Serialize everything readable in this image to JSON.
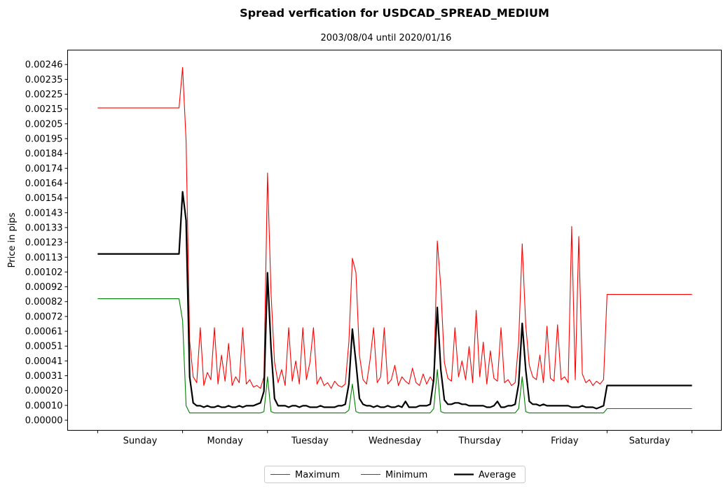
{
  "chart_data": {
    "type": "line",
    "title": "Spread verfication for USDCAD_SPREAD_MEDIUM",
    "subtitle": "2003/08/04 until 2020/01/16",
    "ylabel": "Price in pips",
    "xlabel": "",
    "x_unit": "hour of week (hourly samples starting Sunday 00:00)",
    "categories": [
      "Sunday",
      "Monday",
      "Tuesday",
      "Wednesday",
      "Thursday",
      "Friday",
      "Saturday"
    ],
    "xlim_hours": [
      -8.5,
      176.3
    ],
    "ylim": [
      -7e-05,
      0.00256
    ],
    "y_ticks": [
      "0.00000",
      "0.00010",
      "0.00020",
      "0.00031",
      "0.00041",
      "0.00051",
      "0.00061",
      "0.00072",
      "0.00082",
      "0.00092",
      "0.00102",
      "0.00113",
      "0.00123",
      "0.00133",
      "0.00143",
      "0.00154",
      "0.00164",
      "0.00174",
      "0.00184",
      "0.00195",
      "0.00205",
      "0.00215",
      "0.00225",
      "0.00235",
      "0.00246"
    ],
    "y_tick_step": 0.0001025,
    "grid": false,
    "legend_placement": "bottom-center",
    "series": [
      {
        "name": "Maximum",
        "color": "#ff0000",
        "line_width": 1,
        "values": [
          0.00216,
          0.00216,
          0.00216,
          0.00216,
          0.00216,
          0.00216,
          0.00216,
          0.00216,
          0.00216,
          0.00216,
          0.00216,
          0.00216,
          0.00216,
          0.00216,
          0.00216,
          0.00216,
          0.00216,
          0.00216,
          0.00216,
          0.00216,
          0.00216,
          0.00216,
          0.00216,
          0.00216,
          0.00244,
          0.00193,
          0.00055,
          0.0003,
          0.00026,
          0.00064,
          0.00024,
          0.00033,
          0.00028,
          0.00064,
          0.00025,
          0.00045,
          0.00027,
          0.00053,
          0.00024,
          0.0003,
          0.00026,
          0.00064,
          0.00025,
          0.00028,
          0.00023,
          0.00024,
          0.00022,
          0.0003,
          0.00171,
          0.00088,
          0.0004,
          0.00026,
          0.00035,
          0.00024,
          0.00064,
          0.00027,
          0.00041,
          0.00025,
          0.00064,
          0.00028,
          0.0004,
          0.00064,
          0.00025,
          0.0003,
          0.00024,
          0.00026,
          0.00022,
          0.00027,
          0.00024,
          0.00023,
          0.00025,
          0.00054,
          0.00112,
          0.00102,
          0.00045,
          0.00028,
          0.00025,
          0.00042,
          0.00064,
          0.00026,
          0.0003,
          0.00064,
          0.00025,
          0.00028,
          0.00038,
          0.00024,
          0.0003,
          0.00027,
          0.00025,
          0.00036,
          0.00026,
          0.00024,
          0.00032,
          0.00025,
          0.0003,
          0.00026,
          0.00124,
          0.00092,
          0.0004,
          0.00029,
          0.00027,
          0.00064,
          0.0003,
          0.00041,
          0.00028,
          0.00051,
          0.00026,
          0.00076,
          0.0003,
          0.00054,
          0.00025,
          0.00048,
          0.00029,
          0.00027,
          0.00064,
          0.00026,
          0.00028,
          0.00024,
          0.00026,
          0.00054,
          0.00122,
          0.00066,
          0.00038,
          0.0003,
          0.00028,
          0.00045,
          0.00026,
          0.00065,
          0.00029,
          0.00027,
          0.00066,
          0.00028,
          0.0003,
          0.00026,
          0.00134,
          0.00028,
          0.00127,
          0.00032,
          0.00026,
          0.00028,
          0.00024,
          0.00027,
          0.00025,
          0.00028,
          0.00087,
          0.00087,
          0.00087,
          0.00087,
          0.00087,
          0.00087,
          0.00087,
          0.00087,
          0.00087,
          0.00087,
          0.00087,
          0.00087,
          0.00087,
          0.00087,
          0.00087,
          0.00087,
          0.00087,
          0.00087,
          0.00087,
          0.00087,
          0.00087,
          0.00087,
          0.00087,
          0.00087,
          0.00087
        ]
      },
      {
        "name": "Minimum",
        "color": "#008000",
        "line_width": 1,
        "values": [
          0.00084,
          0.00084,
          0.00084,
          0.00084,
          0.00084,
          0.00084,
          0.00084,
          0.00084,
          0.00084,
          0.00084,
          0.00084,
          0.00084,
          0.00084,
          0.00084,
          0.00084,
          0.00084,
          0.00084,
          0.00084,
          0.00084,
          0.00084,
          0.00084,
          0.00084,
          0.00084,
          0.00084,
          0.00069,
          0.0001,
          5e-05,
          5e-05,
          5e-05,
          5e-05,
          5e-05,
          5e-05,
          5e-05,
          5e-05,
          5e-05,
          5e-05,
          5e-05,
          5e-05,
          5e-05,
          5e-05,
          5e-05,
          5e-05,
          5e-05,
          5e-05,
          5e-05,
          5e-05,
          5e-05,
          6e-05,
          0.0003,
          6e-05,
          5e-05,
          5e-05,
          5e-05,
          5e-05,
          5e-05,
          5e-05,
          5e-05,
          5e-05,
          5e-05,
          5e-05,
          5e-05,
          5e-05,
          5e-05,
          5e-05,
          5e-05,
          5e-05,
          5e-05,
          5e-05,
          5e-05,
          5e-05,
          5e-05,
          7e-05,
          0.00025,
          6e-05,
          5e-05,
          5e-05,
          5e-05,
          5e-05,
          5e-05,
          5e-05,
          5e-05,
          5e-05,
          5e-05,
          5e-05,
          5e-05,
          5e-05,
          5e-05,
          5e-05,
          5e-05,
          5e-05,
          5e-05,
          5e-05,
          5e-05,
          5e-05,
          5e-05,
          8e-05,
          0.00035,
          6e-05,
          5e-05,
          5e-05,
          5e-05,
          5e-05,
          5e-05,
          5e-05,
          5e-05,
          5e-05,
          5e-05,
          5e-05,
          5e-05,
          5e-05,
          5e-05,
          5e-05,
          5e-05,
          5e-05,
          5e-05,
          5e-05,
          5e-05,
          5e-05,
          5e-05,
          8e-05,
          0.0003,
          6e-05,
          5e-05,
          5e-05,
          5e-05,
          5e-05,
          5e-05,
          5e-05,
          5e-05,
          5e-05,
          5e-05,
          5e-05,
          5e-05,
          5e-05,
          5e-05,
          5e-05,
          5e-05,
          5e-05,
          5e-05,
          5e-05,
          5e-05,
          5e-05,
          5e-05,
          5e-05,
          8e-05,
          8e-05,
          8e-05,
          8e-05,
          8e-05,
          8e-05,
          8e-05,
          8e-05,
          8e-05,
          8e-05,
          8e-05,
          8e-05,
          8e-05,
          8e-05,
          8e-05,
          8e-05,
          8e-05,
          8e-05,
          8e-05,
          8e-05,
          8e-05,
          8e-05,
          8e-05,
          8e-05,
          8e-05
        ]
      },
      {
        "name": "Average",
        "color": "#000000",
        "line_width": 2,
        "values": [
          0.00115,
          0.00115,
          0.00115,
          0.00115,
          0.00115,
          0.00115,
          0.00115,
          0.00115,
          0.00115,
          0.00115,
          0.00115,
          0.00115,
          0.00115,
          0.00115,
          0.00115,
          0.00115,
          0.00115,
          0.00115,
          0.00115,
          0.00115,
          0.00115,
          0.00115,
          0.00115,
          0.00115,
          0.00158,
          0.00138,
          0.0003,
          0.00012,
          0.0001,
          0.0001,
          9e-05,
          0.0001,
          9e-05,
          9e-05,
          0.0001,
          9e-05,
          9e-05,
          0.0001,
          9e-05,
          9e-05,
          0.0001,
          9e-05,
          0.0001,
          0.0001,
          0.0001,
          0.00011,
          0.00012,
          0.0002,
          0.00102,
          0.0005,
          0.00015,
          0.0001,
          0.0001,
          0.0001,
          9e-05,
          0.0001,
          0.0001,
          9e-05,
          0.0001,
          0.0001,
          9e-05,
          9e-05,
          9e-05,
          0.0001,
          9e-05,
          9e-05,
          9e-05,
          9e-05,
          0.0001,
          0.0001,
          0.00011,
          0.00025,
          0.00063,
          0.0004,
          0.00015,
          0.00011,
          0.0001,
          0.0001,
          9e-05,
          0.0001,
          9e-05,
          9e-05,
          0.0001,
          9e-05,
          9e-05,
          0.0001,
          9e-05,
          0.00013,
          9e-05,
          9e-05,
          9e-05,
          0.0001,
          0.0001,
          0.0001,
          0.00011,
          0.00028,
          0.00078,
          0.00035,
          0.00014,
          0.00011,
          0.00011,
          0.00012,
          0.00012,
          0.00011,
          0.00011,
          0.0001,
          0.0001,
          0.0001,
          0.0001,
          0.0001,
          9e-05,
          9e-05,
          0.0001,
          0.00013,
          9e-05,
          9e-05,
          0.0001,
          0.0001,
          0.00011,
          0.00025,
          0.00067,
          0.00035,
          0.00013,
          0.00011,
          0.00011,
          0.0001,
          0.00011,
          0.0001,
          0.0001,
          0.0001,
          0.0001,
          0.0001,
          0.0001,
          0.0001,
          9e-05,
          9e-05,
          9e-05,
          0.0001,
          9e-05,
          9e-05,
          9e-05,
          8e-05,
          9e-05,
          0.0001,
          0.00024,
          0.00024,
          0.00024,
          0.00024,
          0.00024,
          0.00024,
          0.00024,
          0.00024,
          0.00024,
          0.00024,
          0.00024,
          0.00024,
          0.00024,
          0.00024,
          0.00024,
          0.00024,
          0.00024,
          0.00024,
          0.00024,
          0.00024,
          0.00024,
          0.00024,
          0.00024,
          0.00024,
          0.00024
        ]
      }
    ]
  }
}
